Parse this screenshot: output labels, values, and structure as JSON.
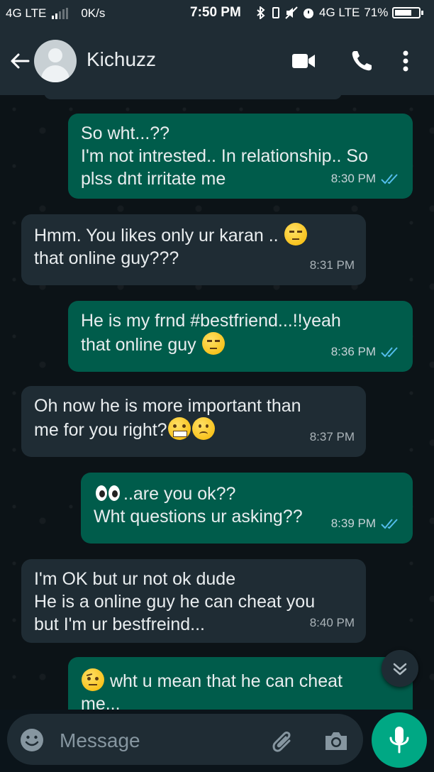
{
  "status_bar": {
    "network_left": "4G LTE",
    "data_speed": "0K/s",
    "time": "7:50 PM",
    "network_right": "4G LTE",
    "battery": "71%",
    "battery_level": 0.71
  },
  "header": {
    "contact_name": "Kichuzz",
    "icons": [
      "back-arrow-icon",
      "avatar",
      "video-call-icon",
      "phone-icon",
      "more-vert-icon"
    ]
  },
  "messages": [
    {
      "direction": "out",
      "text": "So wht...??\nI'm not intrested.. In relationship.. So plss dnt irritate me",
      "time": "8:30 PM",
      "read": true
    },
    {
      "direction": "in",
      "text": "Hmm. You likes only ur karan ..",
      "text2": "that online guy???",
      "emoji": "unamused-face",
      "time": "8:31 PM"
    },
    {
      "direction": "out",
      "text": "He is my frnd #bestfriend...!!yeah",
      "text2": "that online guy",
      "emoji": "unamused-face",
      "time": "8:36 PM",
      "read": true
    },
    {
      "direction": "in",
      "text": "Oh now he is more important than",
      "text2": "me for you right?",
      "emoji": [
        "grimacing-face",
        "frowning-face"
      ],
      "time": "8:37 PM"
    },
    {
      "direction": "out",
      "text": "..are you ok??",
      "text2": "Wht questions ur asking??",
      "emoji": "eyes",
      "time": "8:39 PM",
      "read": true
    },
    {
      "direction": "in",
      "text": "I'm OK but ur not ok dude\nHe is a online guy he can cheat you\nbut I'm ur bestfreind...",
      "time": "8:40 PM"
    },
    {
      "direction": "out",
      "text": "wht u mean that he can cheat",
      "text2": "me...",
      "emoji": "raised-eyebrow-face"
    }
  ],
  "input": {
    "placeholder": "Message",
    "icons": [
      "emoji-icon",
      "attach-icon",
      "camera-icon",
      "mic-icon"
    ]
  },
  "colors": {
    "outgoing_bubble": "#005c4b",
    "incoming_bubble": "#1f2c34",
    "accent": "#00a884",
    "read_ticks": "#53bdeb"
  }
}
